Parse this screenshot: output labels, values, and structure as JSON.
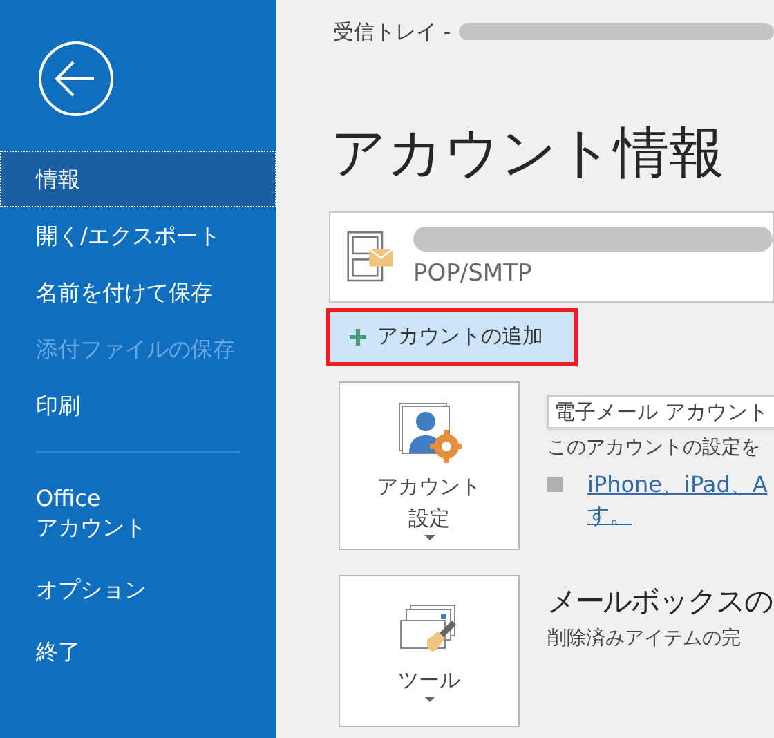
{
  "sidebar": {
    "items": [
      {
        "label": "情報",
        "selected": true,
        "disabled": false
      },
      {
        "label": "開く/エクスポート",
        "selected": false,
        "disabled": false
      },
      {
        "label": "名前を付けて保存",
        "selected": false,
        "disabled": false
      },
      {
        "label": "添付ファイルの保存",
        "selected": false,
        "disabled": true
      },
      {
        "label": "印刷",
        "selected": false,
        "disabled": false
      }
    ],
    "items_below": [
      {
        "label": "Office\nアカウント",
        "selected": false,
        "disabled": false
      },
      {
        "label": "オプション",
        "selected": false,
        "disabled": false
      },
      {
        "label": "終了",
        "selected": false,
        "disabled": false
      }
    ]
  },
  "breadcrumb": "受信トレイ -",
  "heading": "アカウント情報",
  "account": {
    "type": "POP/SMTP"
  },
  "add_account": {
    "label": "アカウントの追加",
    "highlighted": true
  },
  "sections": [
    {
      "button": [
        "アカウント",
        "設定"
      ],
      "description": "このアカウントの設定を",
      "tooltip": "電子メール アカウント",
      "link": [
        "iPhone、iPad、A",
        "す。"
      ]
    },
    {
      "button": "ツール",
      "title": "メールボックスの",
      "description": "削除済みアイテムの完"
    }
  ]
}
